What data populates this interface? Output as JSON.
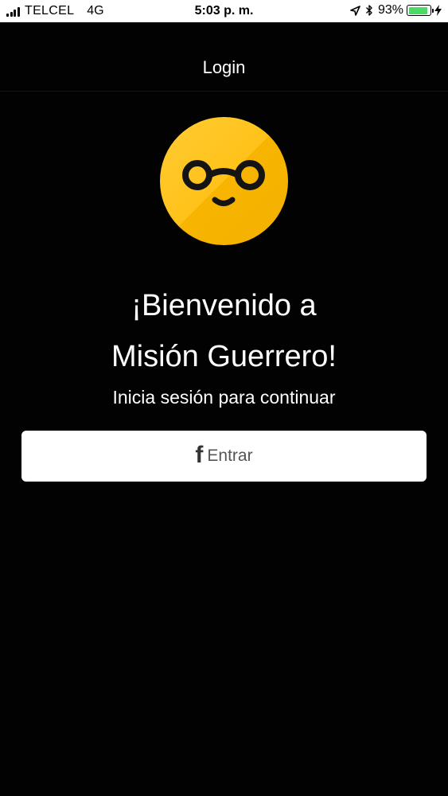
{
  "status_bar": {
    "carrier": "TELCEL",
    "network": "4G",
    "time": "5:03 p. m.",
    "battery_percent_label": "93%",
    "battery_level": 0.93,
    "battery_color": "#4cd964",
    "icons": [
      "signal-icon",
      "location-arrow-icon",
      "bluetooth-icon",
      "battery-icon",
      "charging-bolt-icon"
    ]
  },
  "nav": {
    "title": "Login"
  },
  "logo": {
    "icon": "nerd-smiley-glasses-icon",
    "color": "#ffc21a"
  },
  "welcome": {
    "line1": "¡Bienvenido a",
    "line2": "Misión Guerrero!"
  },
  "subtitle": "Inicia sesión para continuar",
  "login_button": {
    "icon": "facebook-f-icon",
    "icon_glyph": "f",
    "label": "Entrar"
  }
}
